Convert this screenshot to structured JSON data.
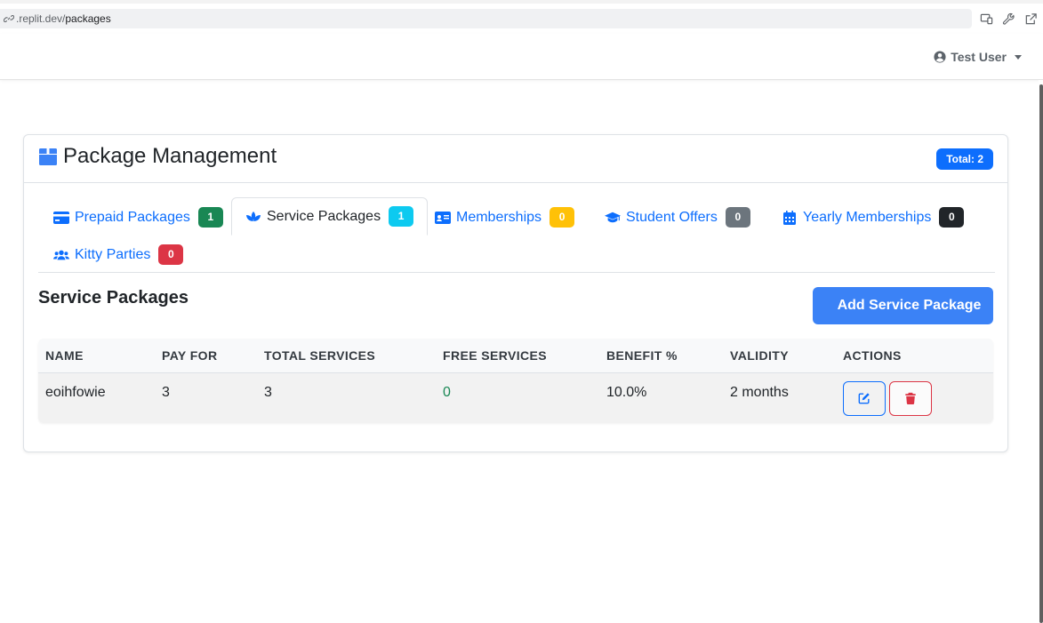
{
  "browser": {
    "url_prefix": ".replit.dev/",
    "url_path": "packages"
  },
  "navbar": {
    "user_label": "Test User"
  },
  "card": {
    "title": "Package Management",
    "total_badge": "Total: 2"
  },
  "tabs": [
    {
      "label": "Prepaid Packages",
      "count": "1",
      "badge_color": "#198754",
      "icon": "credit-card-icon",
      "active": false
    },
    {
      "label": "Service Packages",
      "count": "1",
      "badge_color": "#0dcaf0",
      "icon": "spa-icon",
      "active": true
    },
    {
      "label": "Memberships",
      "count": "0",
      "badge_color": "#ffc107",
      "icon": "id-card-icon",
      "active": false
    },
    {
      "label": "Student Offers",
      "count": "0",
      "badge_color": "#6c757d",
      "icon": "graduation-cap-icon",
      "active": false
    },
    {
      "label": "Yearly Memberships",
      "count": "0",
      "badge_color": "#212529",
      "icon": "calendar-icon",
      "active": false
    },
    {
      "label": "Kitty Parties",
      "count": "0",
      "badge_color": "#dc3545",
      "icon": "users-icon",
      "active": false
    }
  ],
  "section": {
    "title": "Service Packages",
    "add_button": "Add Service Package"
  },
  "table": {
    "headers": [
      "NAME",
      "PAY FOR",
      "TOTAL SERVICES",
      "FREE SERVICES",
      "BENEFIT %",
      "VALIDITY",
      "ACTIONS"
    ],
    "rows": [
      {
        "name": "eoihfowie",
        "pay_for": "3",
        "total_services": "3",
        "free_services": "0",
        "benefit": "10.0%",
        "validity": "2 months"
      }
    ]
  },
  "colors": {
    "primary": "#0d6efd",
    "add_button": "#3b82f6",
    "danger": "#dc3545",
    "success": "#198754"
  }
}
